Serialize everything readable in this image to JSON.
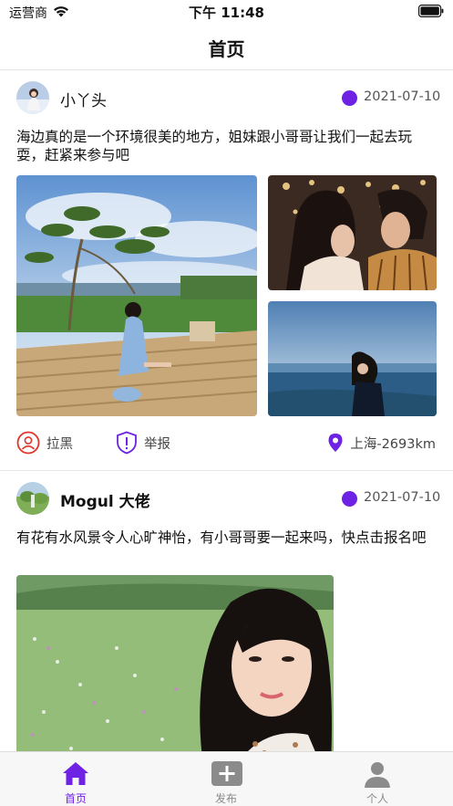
{
  "status_bar": {
    "carrier": "运营商",
    "time": "下午 11:48"
  },
  "nav": {
    "title": "首页"
  },
  "posts": [
    {
      "username": "小丫头",
      "date": "2021-07-10",
      "text": "海边真的是一个环境很美的地方，姐妹跟小哥哥让我们一起去玩耍，赶紧来参与吧",
      "actions": {
        "block": "拉黑",
        "report": "举报",
        "location": "上海-2693km"
      }
    },
    {
      "username": "Mogul 大佬",
      "date": "2021-07-10",
      "text": "有花有水风景令人心旷神怡，有小哥哥要一起来吗，快点击报名吧"
    }
  ],
  "tabs": [
    {
      "label": "首页",
      "icon": "home-icon",
      "active": true
    },
    {
      "label": "发布",
      "icon": "plus-icon",
      "active": false
    },
    {
      "label": "个人",
      "icon": "person-icon",
      "active": false
    }
  ],
  "colors": {
    "accent": "#6e22e3",
    "block_red": "#e0352b"
  }
}
